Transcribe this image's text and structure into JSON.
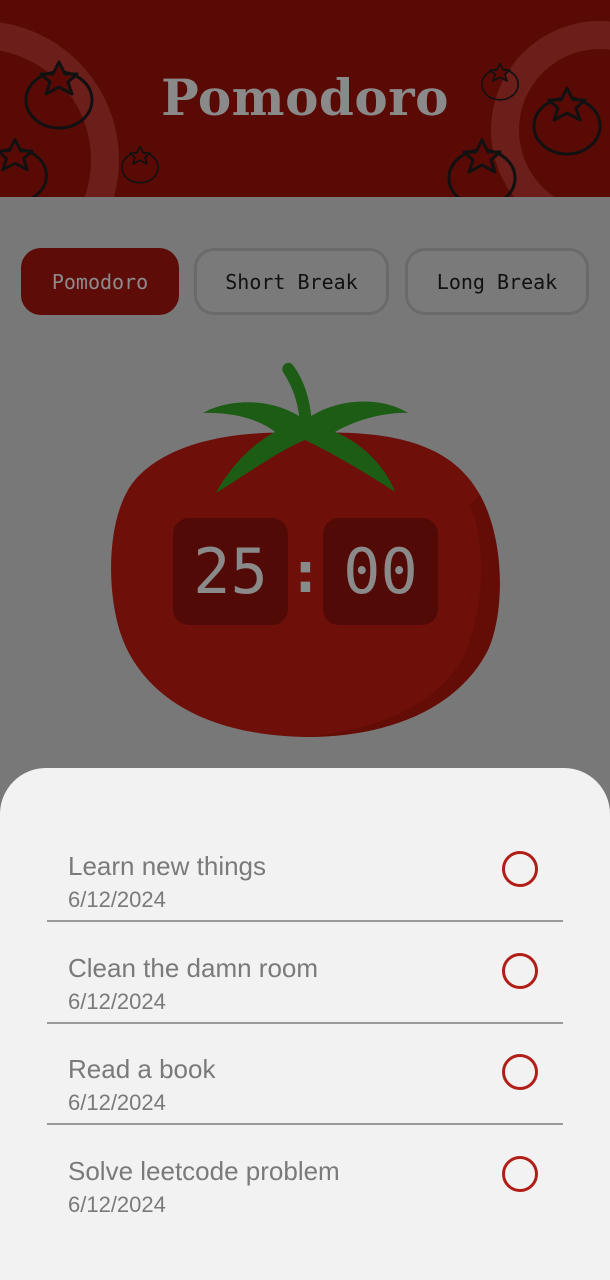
{
  "header": {
    "title": "Pomodoro",
    "decoration_icon": "tomato-outline-icon",
    "background_color": "#5a0a05"
  },
  "modes": {
    "items": [
      "Pomodoro",
      "Short Break",
      "Long Break"
    ],
    "active": "Pomodoro"
  },
  "timer": {
    "minutes": "25",
    "separator": ":",
    "seconds": "00",
    "tomato_color": "#6e0f09",
    "leaf_color": "#1d5c14"
  },
  "tasks": [
    {
      "title": "Learn new things",
      "date": "6/12/2024",
      "done": false
    },
    {
      "title": "Clean the damn room",
      "date": "6/12/2024",
      "done": false
    },
    {
      "title": "Read a book",
      "date": "6/12/2024",
      "done": false
    },
    {
      "title": "Solve leetcode problem",
      "date": "6/12/2024",
      "done": false
    }
  ],
  "colors": {
    "accent": "#b11e17",
    "overlay": "#787878",
    "sheet": "#f2f2f2"
  }
}
